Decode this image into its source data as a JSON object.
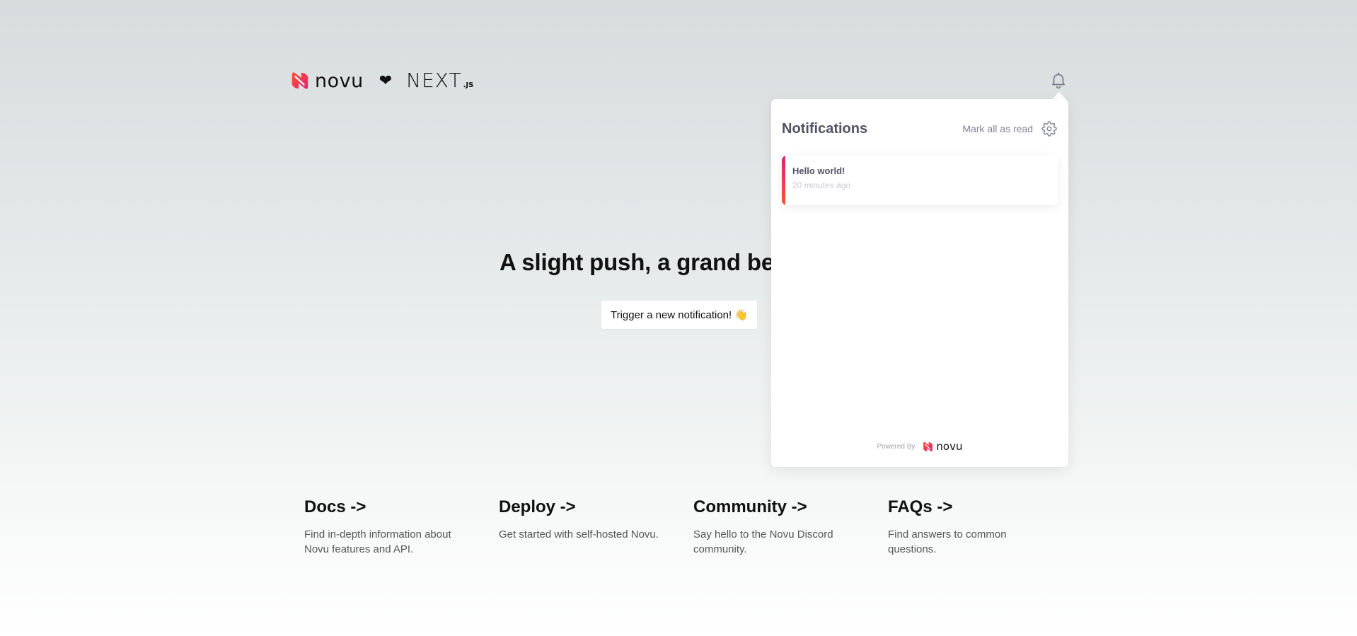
{
  "header": {
    "novu_word": "novu",
    "heart": "❤",
    "next_word": "NEXT",
    "next_suffix": ".JS"
  },
  "hero": {
    "title": "A slight push, a grand be",
    "button_label": "Trigger a new notification! 👋"
  },
  "cards": [
    {
      "title": "Docs ->",
      "description": "Find in-depth information about Novu features and API."
    },
    {
      "title": "Deploy ->",
      "description": "Get started with self-hosted Novu."
    },
    {
      "title": "Community ->",
      "description": "Say hello to the Novu Discord community."
    },
    {
      "title": "FAQs ->",
      "description": "Find answers to common questions."
    }
  ],
  "notifications": {
    "title": "Notifications",
    "mark_all_read": "Mark all as read",
    "items": [
      {
        "title": "Hello world!",
        "time": "20 minutes ago"
      }
    ],
    "powered_by": "Powered By",
    "powered_word": "novu"
  },
  "icons": {
    "bell": "bell-icon",
    "settings": "gear-icon",
    "brand": "novu-logo-icon"
  },
  "colors": {
    "accent_start": "#dd2476",
    "accent_end": "#ff512f",
    "panel_text": "#525266",
    "muted_text": "#828299"
  }
}
